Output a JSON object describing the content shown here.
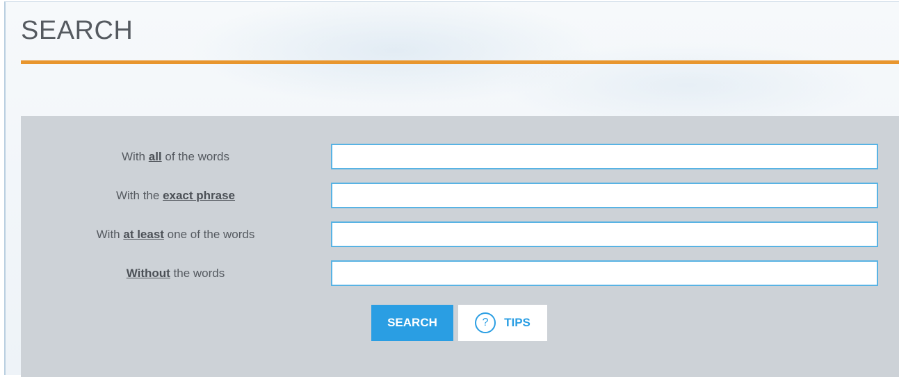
{
  "page": {
    "title": "SEARCH"
  },
  "form": {
    "fields": [
      {
        "prefix": "With ",
        "emphasis": "all",
        "suffix": " of the words",
        "value": ""
      },
      {
        "prefix": "With the ",
        "emphasis": "exact phrase",
        "suffix": "",
        "value": ""
      },
      {
        "prefix": "With ",
        "emphasis": "at least",
        "suffix": " one of the words",
        "value": ""
      },
      {
        "prefix": "",
        "emphasis": "Without",
        "suffix": " the words",
        "value": ""
      }
    ],
    "search_label": "SEARCH",
    "tips_label": "TIPS",
    "tips_icon": "?"
  },
  "colors": {
    "accent_rule": "#e8962e",
    "button_primary": "#2a9ee3",
    "panel_bg": "#cdd2d7"
  },
  "icons": {
    "tips": "help-circle-icon"
  }
}
